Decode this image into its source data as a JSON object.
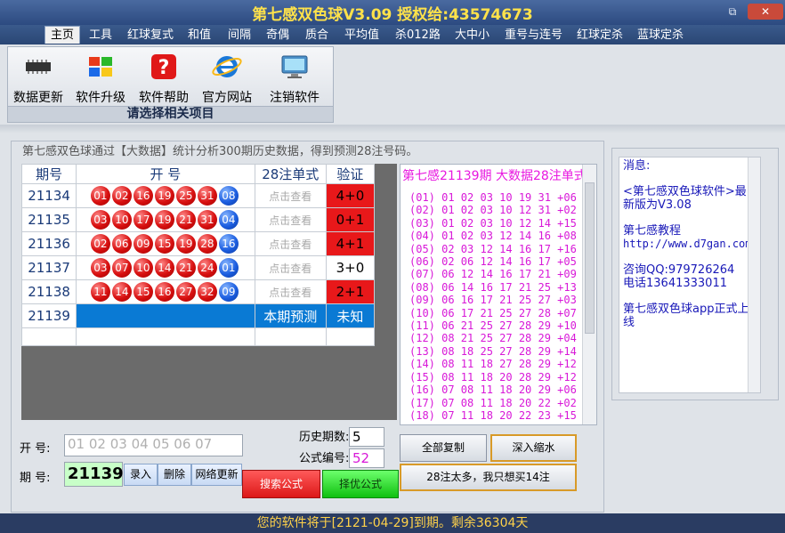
{
  "window": {
    "title": "第七感双色球V3.09  授权给:43574673",
    "minimize_label": "⧉",
    "close_label": "✕"
  },
  "menu": [
    "主页",
    "工具",
    "红球复式",
    "和值",
    "间隔",
    "奇偶",
    "质合",
    "平均值",
    "杀012路",
    "大中小",
    "重号与连号",
    "红球定杀",
    "蓝球定杀"
  ],
  "toolbar": {
    "items": [
      "数据更新",
      "软件升级",
      "软件帮助",
      "官方网站",
      "注销软件"
    ],
    "caption": "请选择相关项目"
  },
  "group_title": "第七感双色球通过【大数据】统计分析300期历史数据，得到预测28注号码。",
  "table": {
    "headers": [
      "期号",
      "开    号",
      "28注单式",
      "验证"
    ],
    "rows": [
      {
        "period": "21134",
        "red": [
          "01",
          "02",
          "16",
          "19",
          "25",
          "31"
        ],
        "blue": "08",
        "view": "点击查看",
        "verify": "4+0",
        "hit": true
      },
      {
        "period": "21135",
        "red": [
          "03",
          "10",
          "17",
          "19",
          "21",
          "31"
        ],
        "blue": "04",
        "view": "点击查看",
        "verify": "0+1",
        "hit": true
      },
      {
        "period": "21136",
        "red": [
          "02",
          "06",
          "09",
          "15",
          "19",
          "28"
        ],
        "blue": "16",
        "view": "点击查看",
        "verify": "4+1",
        "hit": true
      },
      {
        "period": "21137",
        "red": [
          "03",
          "07",
          "10",
          "14",
          "21",
          "24"
        ],
        "blue": "01",
        "view": "点击查看",
        "verify": "3+0",
        "hit": false
      },
      {
        "period": "21138",
        "red": [
          "11",
          "14",
          "15",
          "16",
          "27",
          "32"
        ],
        "blue": "09",
        "view": "点击查看",
        "verify": "2+1",
        "hit": true
      }
    ],
    "predict": {
      "period": "21139",
      "label": "本期预测",
      "status": "未知"
    }
  },
  "prediction": {
    "title": "第七感21139期 大数据28注单式",
    "lines": [
      "(01) 01 02 03 10 19 31 +06",
      "(02) 01 02 03 10 12 31 +02",
      "(03) 01 02 03 10 12 14 +15",
      "(04) 01 02 03 12 14 16 +08",
      "(05) 02 03 12 14 16 17 +16",
      "(06) 02 06 12 14 16 17 +05",
      "(07) 06 12 14 16 17 21 +09",
      "(08) 06 14 16 17 21 25 +13",
      "(09) 06 16 17 21 25 27 +03",
      "(10) 06 17 21 25 27 28 +07",
      "(11) 06 21 25 27 28 29 +10",
      "(12) 08 21 25 27 28 29 +04",
      "(13) 08 18 25 27 28 29 +14",
      "(14) 08 11 18 27 28 29 +12",
      "(15) 08 11 18 20 28 29 +12",
      "(16) 07 08 11 18 20 29 +06",
      "(17) 07 08 11 18 20 22 +02",
      "(18) 07 11 18 20 22 23 +15"
    ]
  },
  "message": {
    "title": "消息:",
    "paras": [
      "<第七感双色球软件>最新版为V3.08",
      "第七感教程",
      "http://www.d7gan.com/",
      "咨询QQ:979726264",
      "电话13641333011",
      "第七感双色球app正式上线"
    ]
  },
  "form": {
    "kai_label": "开  号:",
    "kai_placeholder": "01 02 03 04 05 06 07",
    "qi_label": "期  号:",
    "qi_value": "21139",
    "btn_enter": "录入",
    "btn_delete": "删除",
    "btn_net": "网络更新",
    "hist_label": "历史期数:",
    "hist_value": "5",
    "formula_label": "公式编号:",
    "formula_value": "52",
    "btn_search": "搜索公式",
    "btn_optimize": "择优公式",
    "btn_copy": "全部复制",
    "btn_shrink": "深入缩水",
    "btn_14": "28注太多，我只想买14注"
  },
  "status": "您的软件将于[2121-04-29]到期。剩余36304天"
}
